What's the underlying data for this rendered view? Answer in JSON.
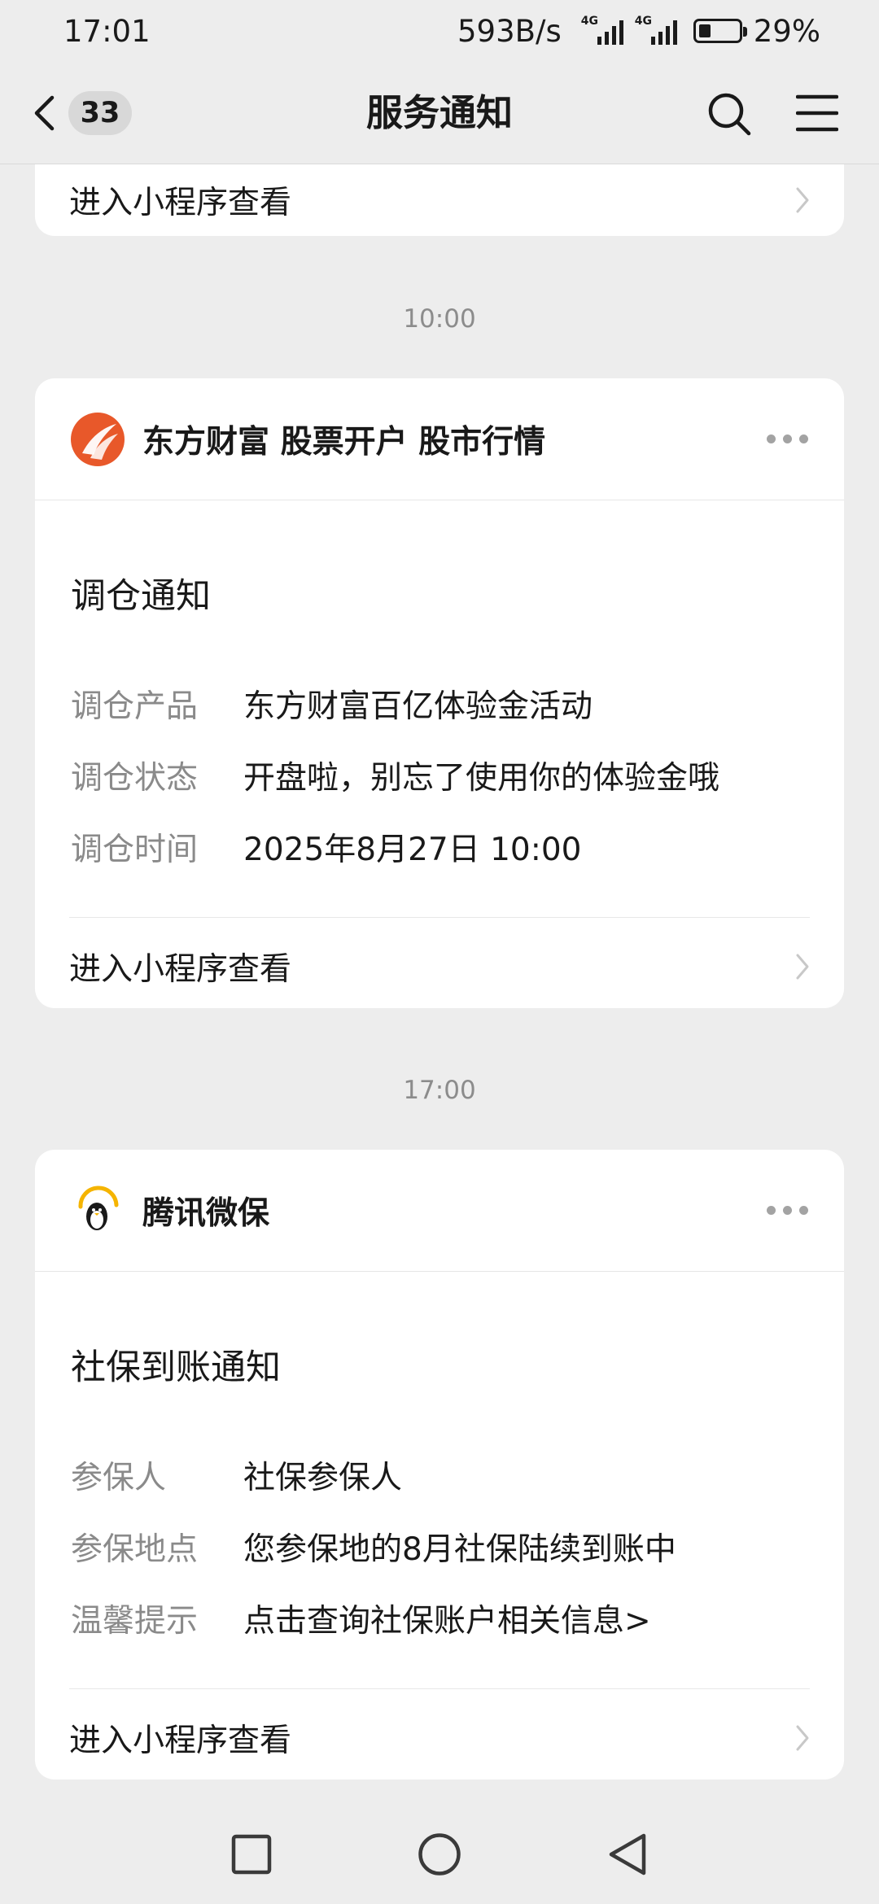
{
  "status_bar": {
    "time": "17:01",
    "net_speed": "593B/s",
    "sim1_tag": "4G",
    "sim2_tag": "4G",
    "battery": "29%"
  },
  "nav": {
    "unread_count": "33",
    "title": "服务通知",
    "icons": [
      "chevron-left-icon",
      "search-icon",
      "menu-icon"
    ]
  },
  "prev_card": {
    "open_label": "进入小程序查看"
  },
  "messages": [
    {
      "time": "10:00",
      "source": "东方财富 股票开户 股市行情",
      "title": "调仓通知",
      "fields": [
        {
          "key": "调仓产品",
          "value": "东方财富百亿体验金活动"
        },
        {
          "key": "调仓状态",
          "value": "开盘啦，别忘了使用你的体验金哦"
        },
        {
          "key": "调仓时间",
          "value": "2025年8月27日 10:00"
        }
      ],
      "open_label": "进入小程序查看",
      "logo_color": "#e8582a"
    },
    {
      "time": "17:00",
      "source": "腾讯微保",
      "title": "社保到账通知",
      "fields": [
        {
          "key": "参保人",
          "value": "社保参保人"
        },
        {
          "key": "参保地点",
          "value": "您参保地的8月社保陆续到账中"
        },
        {
          "key": "温馨提示",
          "value": "点击查询社保账户相关信息>"
        }
      ],
      "open_label": "进入小程序查看",
      "logo_color": "#f5b400"
    }
  ],
  "colors": {
    "background": "#ededed",
    "card": "#ffffff",
    "secondary_text": "#8a8a8a"
  }
}
